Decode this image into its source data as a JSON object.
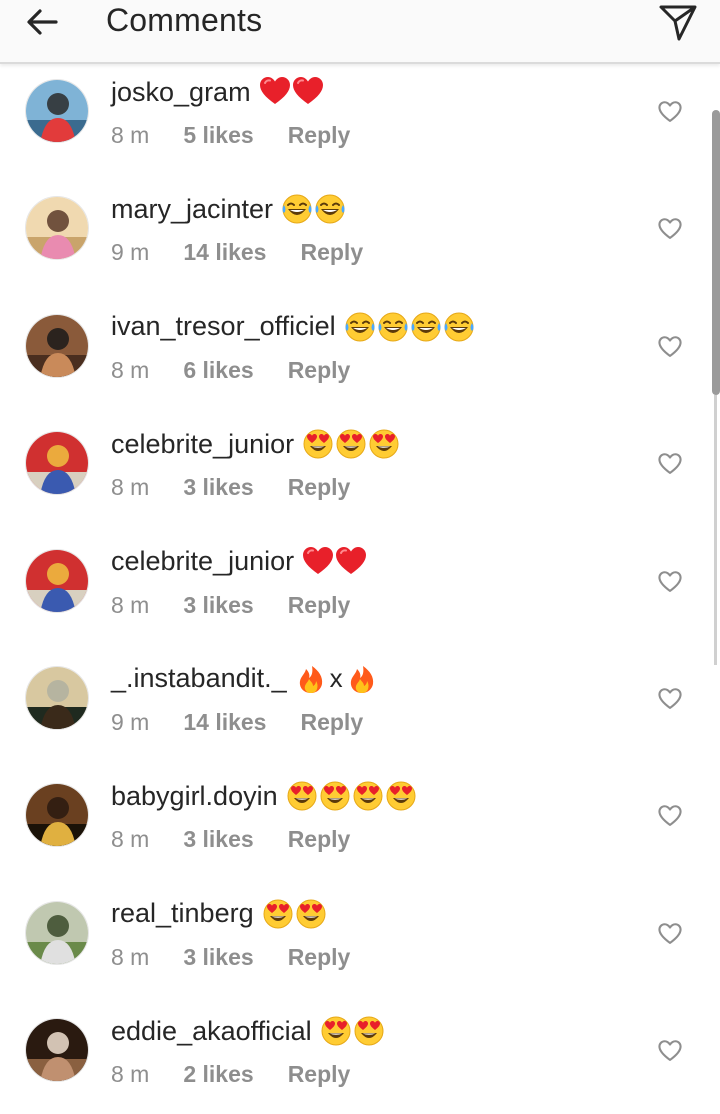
{
  "header": {
    "back_icon": "arrow-left-icon",
    "title": "Comments",
    "send_icon": "paper-plane-icon"
  },
  "comments": [
    {
      "username": "josko_gram",
      "emoji": "heart",
      "emoji_count": 2,
      "time": "8 m",
      "likes": "5 likes",
      "reply": "Reply"
    },
    {
      "username": "mary_jacinter",
      "emoji": "tears-of-joy",
      "emoji_count": 2,
      "time": "9 m",
      "likes": "14 likes",
      "reply": "Reply"
    },
    {
      "username": "ivan_tresor_officiel",
      "emoji": "tears-of-joy",
      "emoji_count": 4,
      "time": "8 m",
      "likes": "6 likes",
      "reply": "Reply"
    },
    {
      "username": "celebrite_junior",
      "emoji": "heart-eyes",
      "emoji_count": 3,
      "time": "8 m",
      "likes": "3 likes",
      "reply": "Reply"
    },
    {
      "username": "celebrite_junior",
      "emoji": "heart",
      "emoji_count": 2,
      "time": "8 m",
      "likes": "3 likes",
      "reply": "Reply"
    },
    {
      "username": "_.instabandit._",
      "emoji": "fire-x-fire",
      "emoji_count": 2,
      "separator": "x",
      "time": "9 m",
      "likes": "14 likes",
      "reply": "Reply"
    },
    {
      "username": "babygirl.doyin",
      "emoji": "heart-eyes",
      "emoji_count": 4,
      "time": "8 m",
      "likes": "3 likes",
      "reply": "Reply"
    },
    {
      "username": "real_tinberg",
      "emoji": "heart-eyes",
      "emoji_count": 2,
      "time": "8 m",
      "likes": "3 likes",
      "reply": "Reply"
    },
    {
      "username": "eddie_akaofficial",
      "emoji": "heart-eyes",
      "emoji_count": 2,
      "time": "8 m",
      "likes": "2 likes",
      "reply": "Reply"
    }
  ],
  "colors": {
    "text_primary": "#262626",
    "text_secondary": "#8e8e8e",
    "heart_red": "#e8202a",
    "emoji_yellow": "#ffcc33",
    "header_bg": "#fafafa"
  }
}
